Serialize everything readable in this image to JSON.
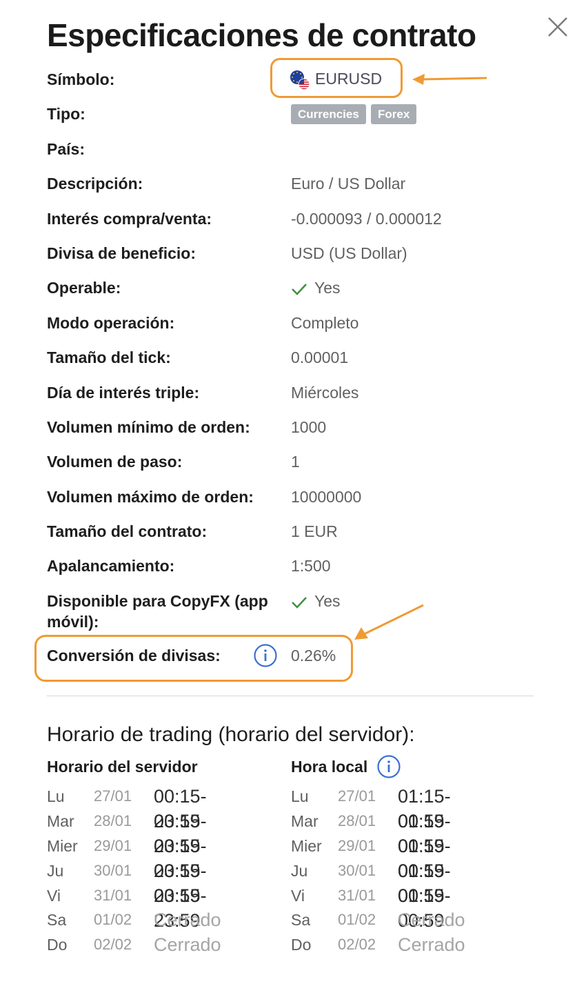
{
  "title": "Especificaciones de contrato",
  "close_icon": "close-icon",
  "symbol": {
    "label": "Símbolo:",
    "value": "EURUSD",
    "icon": "eu-us-flag-icon"
  },
  "type": {
    "label": "Tipo:",
    "tags": [
      "Currencies",
      "Forex"
    ]
  },
  "country": {
    "label": "País:",
    "value": ""
  },
  "specs": [
    {
      "label": "Descripción:",
      "value": "Euro / US Dollar"
    },
    {
      "label": "Interés compra/venta:",
      "value": "-0.000093 / 0.000012"
    },
    {
      "label": "Divisa de beneficio:",
      "value": "USD (US Dollar)"
    },
    {
      "label": "Operable:",
      "value": "Yes"
    },
    {
      "label": "Modo operación:",
      "value": "Completo"
    },
    {
      "label": "Tamaño del tick:",
      "value": "0.00001"
    },
    {
      "label": "Día de interés triple:",
      "value": "Miércoles"
    },
    {
      "label": "Volumen mínimo de orden:",
      "value": "1000"
    },
    {
      "label": "Volumen de paso:",
      "value": "1"
    },
    {
      "label": "Volumen máximo de orden:",
      "value": "10000000"
    },
    {
      "label": "Tamaño del contrato:",
      "value": "1 EUR"
    },
    {
      "label": "Apalancamiento:",
      "value": "1:500"
    }
  ],
  "copyfx": {
    "label_line1": "Disponible para CopyFX (app",
    "label_line2": "móvil):",
    "value": "Yes"
  },
  "conversion": {
    "label": "Conversión de divisas:",
    "value": "0.26%"
  },
  "schedule": {
    "title": "Horario de trading (horario del servidor):",
    "server_header": "Horario del servidor",
    "local_header": "Hora local",
    "server": [
      {
        "day": "Lu",
        "date": "27/01",
        "time": "00:15-23:59"
      },
      {
        "day": "Mar",
        "date": "28/01",
        "time": "00:15-23:59"
      },
      {
        "day": "Mier",
        "date": "29/01",
        "time": "00:15-23:59"
      },
      {
        "day": "Ju",
        "date": "30/01",
        "time": "00:15-23:59"
      },
      {
        "day": "Vi",
        "date": "31/01",
        "time": "00:15-23:59"
      },
      {
        "day": "Sa",
        "date": "01/02",
        "time": "Cerrado"
      },
      {
        "day": "Do",
        "date": "02/02",
        "time": "Cerrado"
      }
    ],
    "local": [
      {
        "day": "Lu",
        "date": "27/01",
        "time": "01:15-00:59"
      },
      {
        "day": "Mar",
        "date": "28/01",
        "time": "01:15-00:59"
      },
      {
        "day": "Mier",
        "date": "29/01",
        "time": "01:15-00:59"
      },
      {
        "day": "Ju",
        "date": "30/01",
        "time": "01:15-00:59"
      },
      {
        "day": "Vi",
        "date": "31/01",
        "time": "01:15-00:59"
      },
      {
        "day": "Sa",
        "date": "01/02",
        "time": "Cerrado"
      },
      {
        "day": "Do",
        "date": "02/02",
        "time": "Cerrado"
      }
    ]
  },
  "colors": {
    "highlight": "#f09a33",
    "info": "#3b6fd4",
    "check": "#3f8f3a",
    "tag": "#a8adb3"
  }
}
